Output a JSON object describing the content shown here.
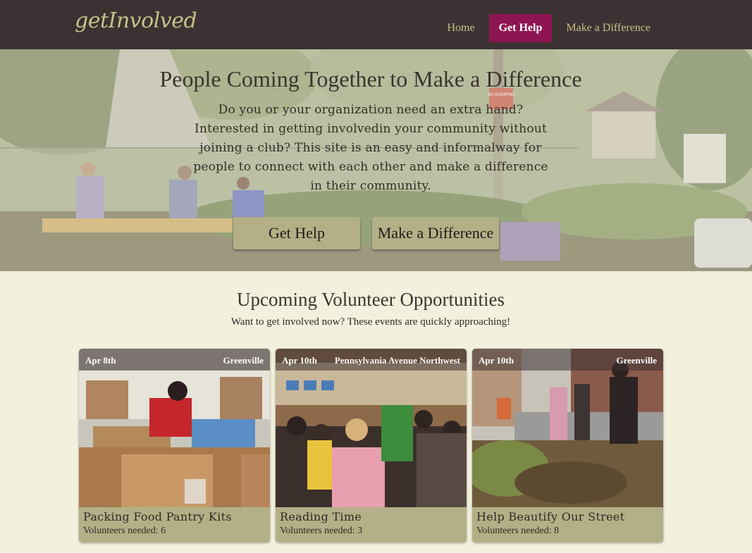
{
  "header": {
    "logo": "getInvolved",
    "nav": [
      {
        "label": "Home"
      },
      {
        "label": "Get Help"
      },
      {
        "label": "Make a Difference"
      }
    ]
  },
  "hero": {
    "title": "People Coming Together to Make a Difference",
    "text": "Do you or your organization need an extra hand? Interested in getting involvedin your community without joining a club? This site is an easy and informalway for people to connect with each other and make a difference in their community.",
    "buttons": [
      {
        "label": "Get Help"
      },
      {
        "label": "Make a Difference"
      }
    ],
    "sign_text": "NO DUMPING"
  },
  "opportunities": {
    "title": "Upcoming Volunteer Opportunities",
    "subtitle": "Want to get involved now? These events are quickly approaching!",
    "cards": [
      {
        "date": "Apr 8th",
        "location": "Greenville",
        "title": "Packing Food Pantry Kits",
        "volunteers": "Volunteers needed: 6"
      },
      {
        "date": "Apr 10th",
        "location": "Pennsylvania Avenue Northwest",
        "title": "Reading Time",
        "volunteers": "Volunteers needed: 3"
      },
      {
        "date": "Apr 10th",
        "location": "Greenville",
        "title": "Help Beautify Our Street",
        "volunteers": "Volunteers needed: 8"
      }
    ]
  },
  "colors": {
    "topbar": "#3c3233",
    "accent": "#8e1452",
    "logo": "#c9c08a",
    "button": "#b3b087",
    "page_bg": "#f2f1de"
  }
}
